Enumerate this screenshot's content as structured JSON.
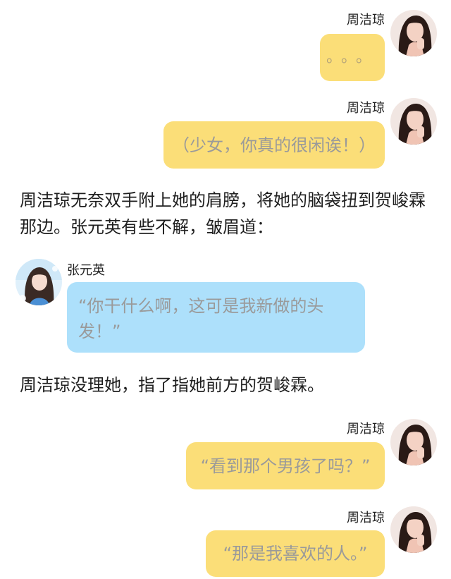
{
  "messages": [
    {
      "speaker": "周洁琼",
      "text": "。。。"
    },
    {
      "speaker": "周洁琼",
      "text": "（少女，你真的很闲诶！）"
    },
    {
      "narration": "周洁琼无奈双手附上她的肩膀，将她的脑袋扭到贺峻霖那边。张元英有些不解，皱眉道："
    },
    {
      "speaker": "张元英",
      "text": "“你干什么啊，这可是我新做的头发！”"
    },
    {
      "narration": "周洁琼没理她，指了指她前方的贺峻霖。"
    },
    {
      "speaker": "周洁琼",
      "text": "“看到那个男孩了吗？”"
    },
    {
      "speaker": "周洁琼",
      "text": "“那是我喜欢的人。”"
    }
  ],
  "colors": {
    "yellow_bubble": "#fbde78",
    "blue_bubble": "#ade0fb",
    "bubble_text": "#9a9a9a",
    "narration_text": "#1e1e1e"
  },
  "avatars": [
    "avatar-zhou-jieqiong",
    "avatar-zhang-yuanying"
  ]
}
